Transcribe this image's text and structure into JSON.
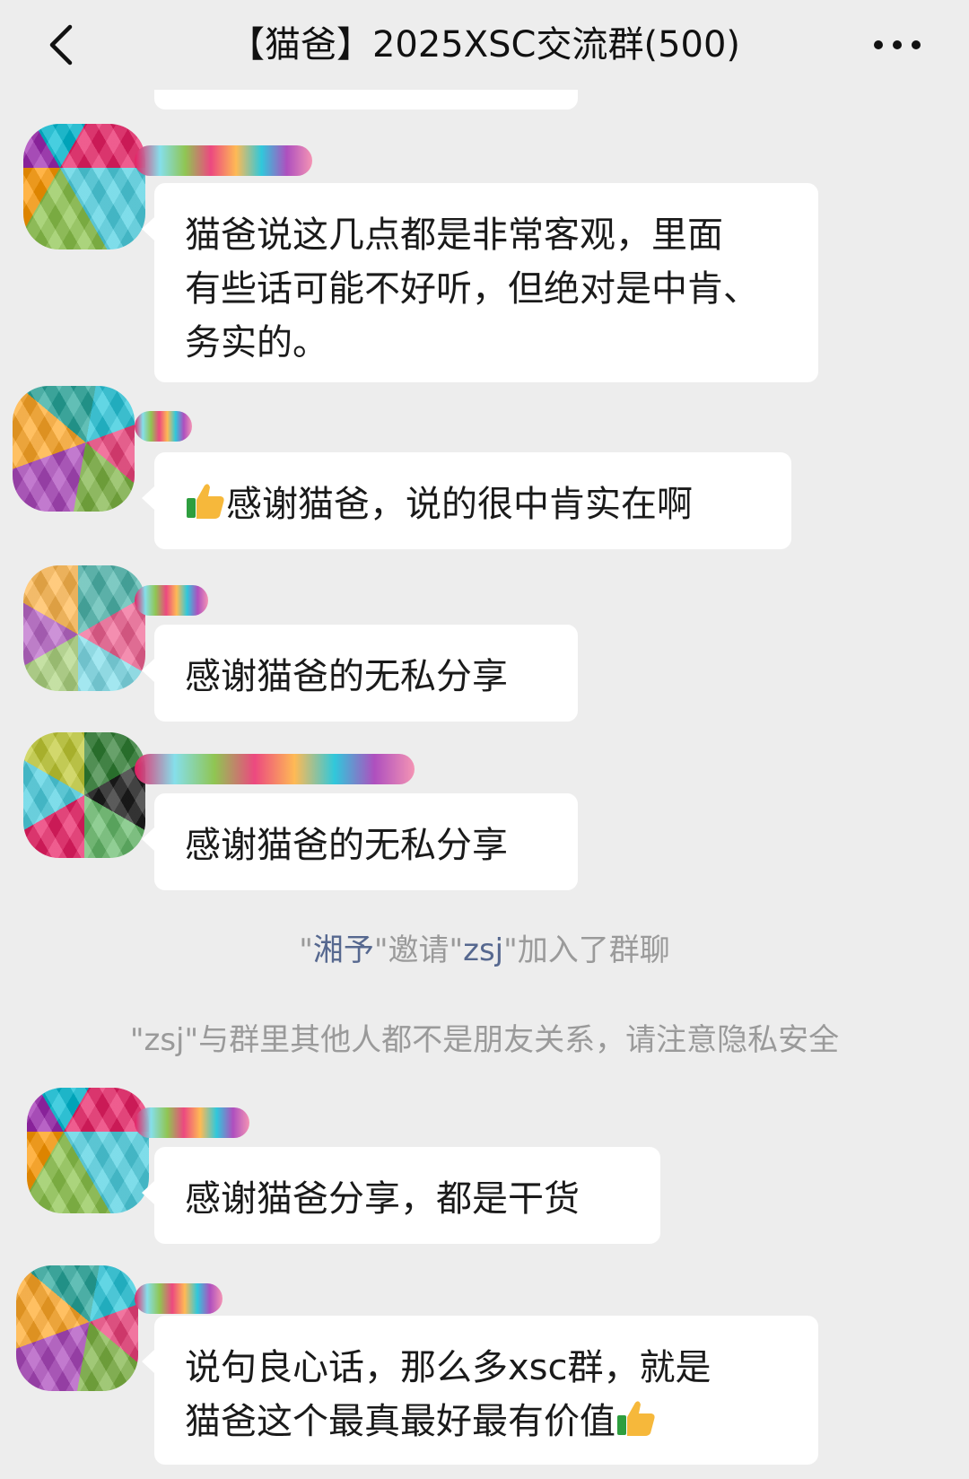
{
  "header": {
    "title": "【猫爸】2025XSC交流群(500)",
    "back_icon": "chevron-left-icon",
    "more_icon": "more-dots-icon"
  },
  "messages": [
    {
      "text_lines": [
        "猫爸说这几点都是非常客观，里面",
        "有些话可能不好听，但绝对是中肯、",
        "务实的。"
      ]
    },
    {
      "emoji": "thumbs-up-icon",
      "text": "感谢猫爸，说的很中肯实在啊"
    },
    {
      "text": "感谢猫爸的无私分享"
    },
    {
      "text": "感谢猫爸的无私分享"
    },
    {
      "text": "感谢猫爸分享，都是干货"
    },
    {
      "text_lines": [
        "说句良心话，那么多xsc群，就是",
        "猫爸这个最真最好最有价值"
      ],
      "emoji": "thumbs-up-icon"
    }
  ],
  "system": {
    "invite": {
      "q1": "\"",
      "inviter": "湘予",
      "q2": "\"邀请\"",
      "invitee": "zsj",
      "q3": "\"加入了群聊"
    },
    "notice": "\"zsj\"与群里其他人都不是朋友关系，请注意隐私安全"
  },
  "colors": {
    "background": "#ededed",
    "bubble": "#ffffff",
    "system_text": "#9a9a9a",
    "link_name": "#56688f"
  }
}
